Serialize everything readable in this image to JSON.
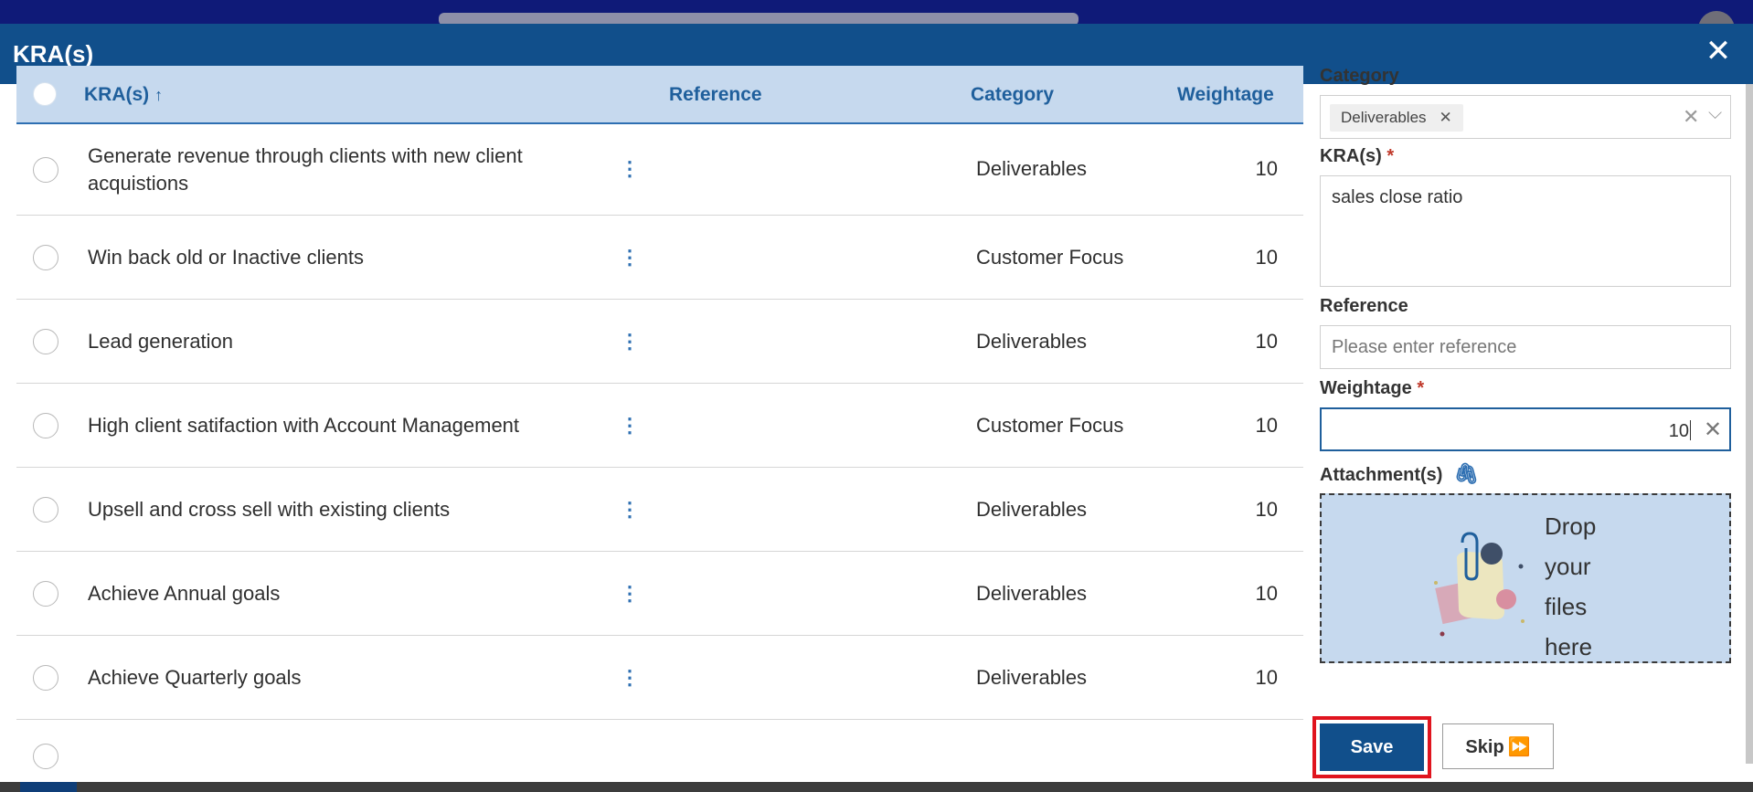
{
  "modal": {
    "title": "KRA(s)"
  },
  "table": {
    "columns": {
      "kra": "KRA(s)",
      "sort_indicator": "↑",
      "reference": "Reference",
      "category": "Category",
      "weightage": "Weightage"
    },
    "rows": [
      {
        "kra": "Generate revenue through clients with new client acquistions",
        "category": "Deliverables",
        "weightage": "10"
      },
      {
        "kra": "Win back old or Inactive clients",
        "category": "Customer Focus",
        "weightage": "10"
      },
      {
        "kra": "Lead generation",
        "category": "Deliverables",
        "weightage": "10"
      },
      {
        "kra": "High client satifaction with Account Management",
        "category": "Customer Focus",
        "weightage": "10"
      },
      {
        "kra": "Upsell and cross sell with existing clients",
        "category": "Deliverables",
        "weightage": "10"
      },
      {
        "kra": "Achieve Annual goals",
        "category": "Deliverables",
        "weightage": "10"
      },
      {
        "kra": "Achieve Quarterly goals",
        "category": "Deliverables",
        "weightage": "10"
      }
    ]
  },
  "form": {
    "category_label": "Category",
    "category_tag": "Deliverables",
    "kra_label": "KRA(s)",
    "kra_value": "sales close ratio",
    "reference_label": "Reference",
    "reference_placeholder": "Please enter reference",
    "weightage_label": "Weightage",
    "weightage_value": "10",
    "attachments_label": "Attachment(s)",
    "dropzone_text": "Drop your files here",
    "required_mark": "*"
  },
  "buttons": {
    "save": "Save",
    "skip": "Skip"
  },
  "colors": {
    "header": "#114f8b",
    "table_header_bg": "#c6d9ee",
    "accent": "#1f5f9c",
    "highlight": "#e0141e"
  },
  "icons": {
    "close": "close-icon",
    "row_menu": "kebab-menu-icon",
    "attachment": "paperclip-icon",
    "skip": "fast-forward-icon"
  }
}
